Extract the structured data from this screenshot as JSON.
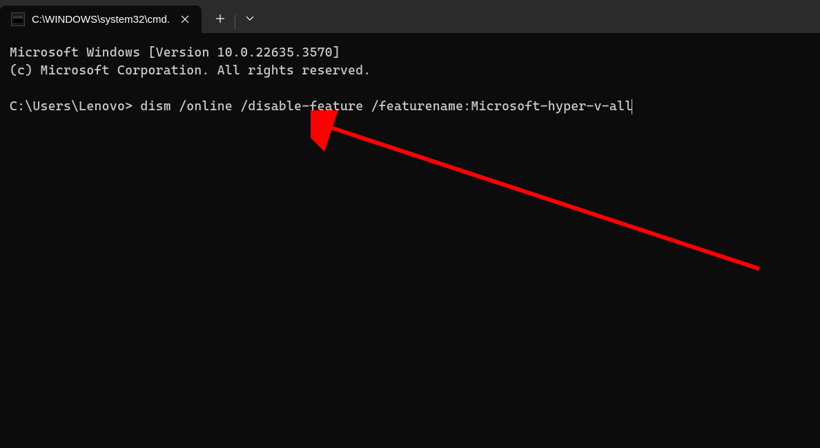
{
  "tab": {
    "title": "C:\\WINDOWS\\system32\\cmd."
  },
  "terminal": {
    "line1": "Microsoft Windows [Version 10.0.22635.3570]",
    "line2": "(c) Microsoft Corporation. All rights reserved.",
    "blank": "",
    "prompt": "C:\\Users\\Lenovo>",
    "command": "dism /online /disable-feature /featurename:Microsoft-hyper-v-all"
  }
}
